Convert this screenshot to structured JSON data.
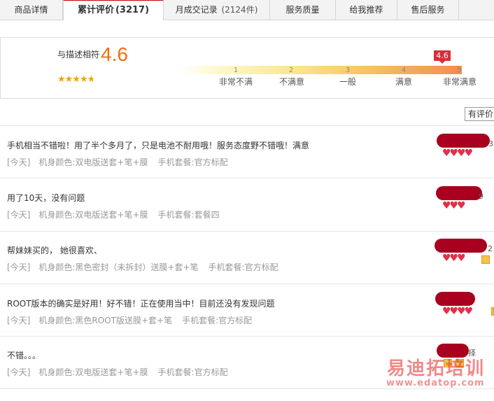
{
  "tabs": [
    {
      "label": "商品详情",
      "count": ""
    },
    {
      "label": "累计评价",
      "count": "(3217)"
    },
    {
      "label": "月成交记录",
      "count": "(2124件)"
    },
    {
      "label": "服务质量",
      "count": ""
    },
    {
      "label": "给我推荐",
      "count": ""
    },
    {
      "label": "售后服务",
      "count": ""
    }
  ],
  "rating": {
    "label": "与描述相符",
    "score": "4.6",
    "marker": "4.6",
    "stars_value": 4.6,
    "ticks": [
      "1",
      "2",
      "3",
      "4",
      "5"
    ],
    "levels": [
      "非常不满",
      "不满意",
      "一般",
      "满意",
      "非常满意"
    ]
  },
  "filter": {
    "label": "有评价"
  },
  "reviews": [
    {
      "text": "手机相当不错啦！用了半个多月了，只是电池不耐用哦！服务态度野不错哦！满意",
      "date": "[今天]",
      "color": "机身颜色:双电版送套+笔+膜",
      "package": "手机套餐:官方标配",
      "edge": "3"
    },
    {
      "text": "用了10天，没有问题",
      "date": "[今天]",
      "color": "机身颜色:双电版送套+笔+膜",
      "package": "手机套餐:套餐四",
      "edge": "9"
    },
    {
      "text": "帮妹妹买的， 她很喜欢、",
      "date": "[今天]",
      "color": "机身颜色:黑色密封（未拆封）送膜+套+笔",
      "package": "手机套餐:官方标配",
      "edge": "2"
    },
    {
      "text": "ROOT版本的确实是好用！好不错！正在使用当中！目前还没有发现问题",
      "date": "[今天]",
      "color": "机身颜色:黑色ROOT版送膜+套+笔",
      "package": "手机套餐:官方标配",
      "edge": ""
    },
    {
      "text": "不错。。。",
      "date": "[今天]",
      "color": "机身颜色:双电版送套+笔+膜",
      "package": "手机套餐:官方标配",
      "edge": "择"
    }
  ],
  "watermark": {
    "cn": "易迪拓培训",
    "url": "www.edatop.com"
  },
  "colors": {
    "accent": "#c40000",
    "score": "#f46d0b",
    "meta": "#999999"
  }
}
